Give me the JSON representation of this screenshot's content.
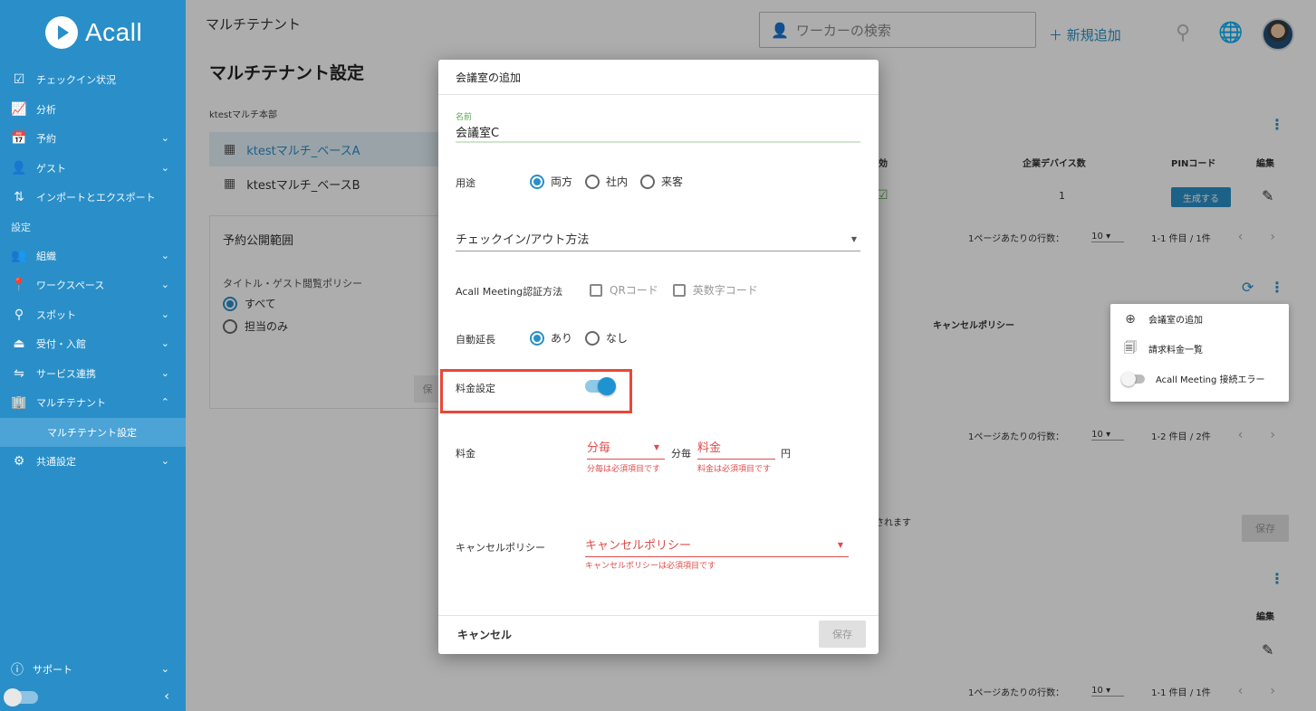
{
  "app": {
    "brand": "Acall"
  },
  "sidebar": {
    "items": [
      {
        "label": "チェックイン状況",
        "icon": "checkbox-icon"
      },
      {
        "label": "分析",
        "icon": "chart-line-icon"
      },
      {
        "label": "予約",
        "icon": "calendar-clock-icon",
        "expandable": true
      },
      {
        "label": "ゲスト",
        "icon": "guest-icon",
        "expandable": true
      },
      {
        "label": "インポートとエクスポート",
        "icon": "import-export-icon"
      }
    ],
    "section_label": "設定",
    "settings_items": [
      {
        "label": "組織",
        "icon": "group-icon",
        "expandable": true
      },
      {
        "label": "ワークスペース",
        "icon": "location-pin-icon",
        "expandable": true
      },
      {
        "label": "スポット",
        "icon": "spot-pin-icon",
        "expandable": true
      },
      {
        "label": "受付・入館",
        "icon": "reception-icon",
        "expandable": true
      },
      {
        "label": "サービス連携",
        "icon": "service-link-icon",
        "expandable": true
      },
      {
        "label": "マルチテナント",
        "icon": "building-icon",
        "expandable": true,
        "expanded": true
      }
    ],
    "sub_item": "マルチテナント設定",
    "common": {
      "label": "共通設定",
      "icon": "gears-icon"
    },
    "support": {
      "label": "サポート",
      "icon": "help-icon"
    }
  },
  "header": {
    "breadcrumb": "マルチテナント",
    "search_placeholder": "ワーカーの検索",
    "add_new": "新規追加"
  },
  "page": {
    "title": "マルチテナント設定",
    "tenant_parent": "ktestマルチ本部",
    "tenants": [
      "ktestマルチ_ベースA",
      "ktestマルチ_ベースB"
    ],
    "scope_card": {
      "title": "予約公開範囲",
      "policy_label": "タイトル・ゲスト閲覧ポリシー",
      "options": [
        "すべて",
        "担当のみ"
      ]
    },
    "background": {
      "col_valid": "効",
      "col_device_count": "企業デバイス数",
      "col_pin": "PINコード",
      "col_edit": "編集",
      "device_count_value": "1",
      "generate_btn": "生成する",
      "rows_per_page": "1ページあたりの行数：",
      "rows_value": "10",
      "range_1": "1-1 件目 / 1件",
      "range_2": "1-2 件目 / 2件",
      "cancel_policy_col": "キャンセルポリシー",
      "notice_tail": "されます",
      "save": "保存"
    }
  },
  "context_menu": {
    "items": [
      "会議室の追加",
      "請求料金一覧",
      "Acall Meeting 接続エラー"
    ]
  },
  "modal": {
    "title": "会議室の追加",
    "name_label": "名前",
    "name_value": "会議室C",
    "usage_label": "用途",
    "usage_options": [
      "両方",
      "社内",
      "来客"
    ],
    "checkin_placeholder": "チェックイン/アウト方法",
    "auth_label": "Acall Meeting認証方法",
    "auth_options": [
      "QRコード",
      "英数字コード"
    ],
    "auto_extend_label": "自動延長",
    "auto_extend_options": [
      "あり",
      "なし"
    ],
    "fee_setting_label": "料金設定",
    "fee_label": "料金",
    "per_minute_select": "分毎",
    "per_minute_text": "分毎",
    "fee_input_placeholder": "料金",
    "yen": "円",
    "per_minute_error": "分毎は必須項目です",
    "fee_error": "料金は必須項目です",
    "cancel_policy_label": "キャンセルポリシー",
    "cancel_policy_placeholder": "キャンセルポリシー",
    "cancel_policy_error": "キャンセルポリシーは必須項目です",
    "cancel_btn": "キャンセル",
    "save_btn": "保存"
  }
}
